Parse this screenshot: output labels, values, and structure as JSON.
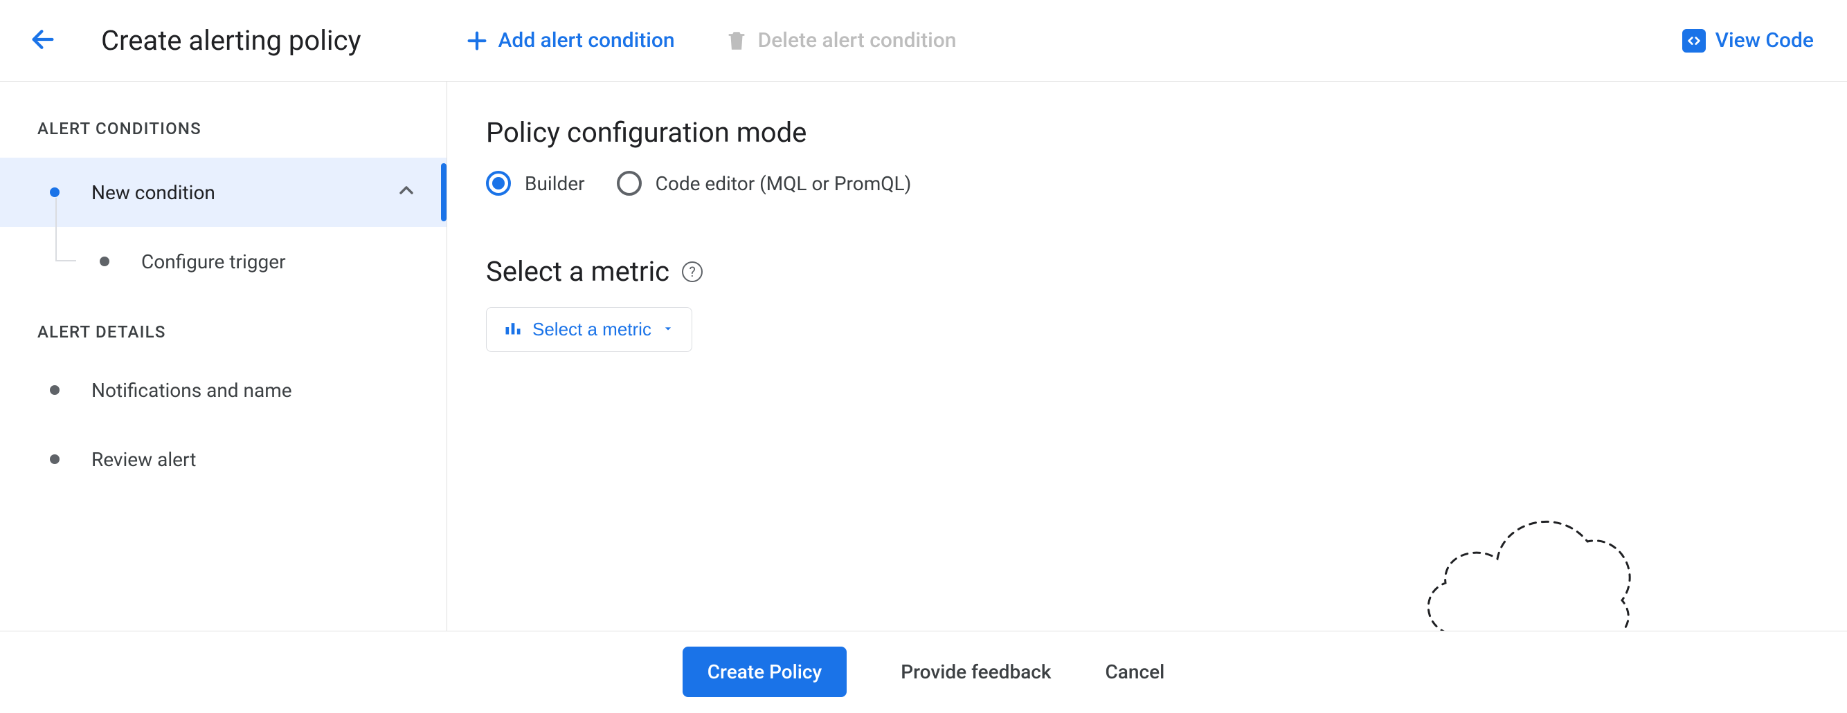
{
  "header": {
    "title": "Create alerting policy",
    "add_condition": "Add alert condition",
    "delete_condition": "Delete alert condition",
    "view_code": "View Code"
  },
  "sidebar": {
    "conditions_label": "ALERT CONDITIONS",
    "new_condition": "New condition",
    "configure_trigger": "Configure trigger",
    "details_label": "ALERT DETAILS",
    "notifications": "Notifications and name",
    "review": "Review alert"
  },
  "main": {
    "config_mode_title": "Policy configuration mode",
    "radio_builder": "Builder",
    "radio_code": "Code editor (MQL or PromQL)",
    "select_metric_title": "Select a metric",
    "select_metric_btn": "Select a metric"
  },
  "footer": {
    "create": "Create Policy",
    "feedback": "Provide feedback",
    "cancel": "Cancel"
  }
}
